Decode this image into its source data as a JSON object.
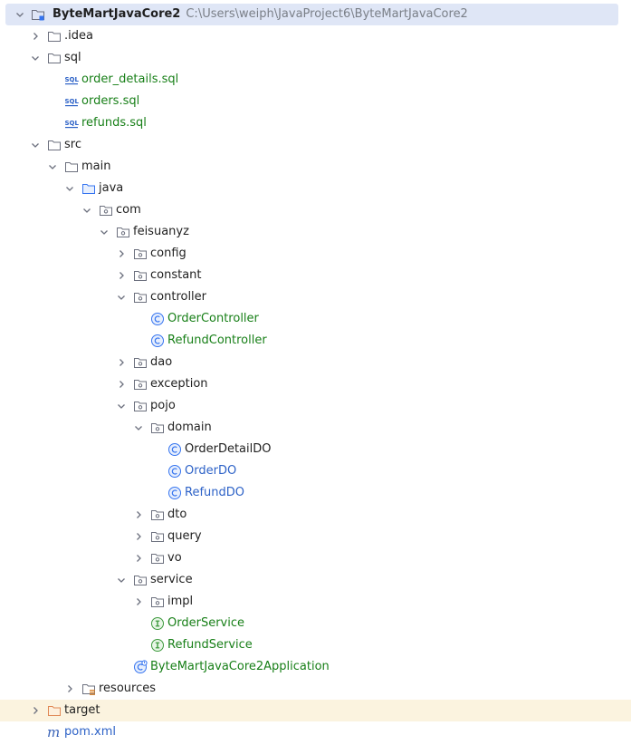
{
  "project_tree": {
    "root": {
      "name": "ByteMartJavaCore2",
      "path": "C:\\Users\\weiph\\JavaProject6\\ByteMartJavaCore2"
    },
    "nodes": [
      {
        "label": ".idea",
        "icon": "folder-icon",
        "expanded": false,
        "depth": 1
      },
      {
        "label": "sql",
        "icon": "folder-icon",
        "expanded": true,
        "depth": 1
      },
      {
        "label": "order_details.sql",
        "icon": "sql-file-icon",
        "depth": 2,
        "vcs": "added"
      },
      {
        "label": "orders.sql",
        "icon": "sql-file-icon",
        "depth": 2,
        "vcs": "added"
      },
      {
        "label": "refunds.sql",
        "icon": "sql-file-icon",
        "depth": 2,
        "vcs": "added"
      },
      {
        "label": "src",
        "icon": "folder-icon",
        "expanded": true,
        "depth": 1
      },
      {
        "label": "main",
        "icon": "folder-icon",
        "expanded": true,
        "depth": 2
      },
      {
        "label": "java",
        "icon": "source-folder-icon",
        "expanded": true,
        "depth": 3
      },
      {
        "label": "com",
        "icon": "package-icon",
        "expanded": true,
        "depth": 4
      },
      {
        "label": "feisuanyz",
        "icon": "package-icon",
        "expanded": true,
        "depth": 5
      },
      {
        "label": "config",
        "icon": "package-icon",
        "expanded": false,
        "depth": 6
      },
      {
        "label": "constant",
        "icon": "package-icon",
        "expanded": false,
        "depth": 6
      },
      {
        "label": "controller",
        "icon": "package-icon",
        "expanded": true,
        "depth": 6
      },
      {
        "label": "OrderController",
        "icon": "class-icon",
        "depth": 7,
        "vcs": "added"
      },
      {
        "label": "RefundController",
        "icon": "class-icon",
        "depth": 7,
        "vcs": "added"
      },
      {
        "label": "dao",
        "icon": "package-icon",
        "expanded": false,
        "depth": 6
      },
      {
        "label": "exception",
        "icon": "package-icon",
        "expanded": false,
        "depth": 6
      },
      {
        "label": "pojo",
        "icon": "package-icon",
        "expanded": true,
        "depth": 6
      },
      {
        "label": "domain",
        "icon": "package-icon",
        "expanded": true,
        "depth": 7
      },
      {
        "label": "OrderDetailDO",
        "icon": "class-icon",
        "depth": 8
      },
      {
        "label": "OrderDO",
        "icon": "class-icon",
        "depth": 8,
        "vcs": "modified"
      },
      {
        "label": "RefundDO",
        "icon": "class-icon",
        "depth": 8,
        "vcs": "modified"
      },
      {
        "label": "dto",
        "icon": "package-icon",
        "expanded": false,
        "depth": 7
      },
      {
        "label": "query",
        "icon": "package-icon",
        "expanded": false,
        "depth": 7
      },
      {
        "label": "vo",
        "icon": "package-icon",
        "expanded": false,
        "depth": 7
      },
      {
        "label": "service",
        "icon": "package-icon",
        "expanded": true,
        "depth": 6
      },
      {
        "label": "impl",
        "icon": "package-icon",
        "expanded": false,
        "depth": 7
      },
      {
        "label": "OrderService",
        "icon": "interface-icon",
        "depth": 7,
        "vcs": "added"
      },
      {
        "label": "RefundService",
        "icon": "interface-icon",
        "depth": 7,
        "vcs": "added"
      },
      {
        "label": "ByteMartJavaCore2Application",
        "icon": "spring-boot-app-icon",
        "depth": 6,
        "vcs": "added"
      },
      {
        "label": "resources",
        "icon": "resources-folder-icon",
        "expanded": false,
        "depth": 3
      },
      {
        "label": "target",
        "icon": "excluded-folder-icon",
        "expanded": false,
        "depth": 1,
        "excluded": true
      },
      {
        "label": "pom.xml",
        "icon": "maven-icon",
        "depth": 1,
        "vcs": "modified"
      }
    ]
  },
  "colors": {
    "selected_row_bg": "#dfe6f6",
    "excluded_row_bg": "#fbf3df",
    "vcs_added": "#177f17",
    "vcs_modified": "#2d62c7",
    "path_text": "#7a7f87"
  }
}
